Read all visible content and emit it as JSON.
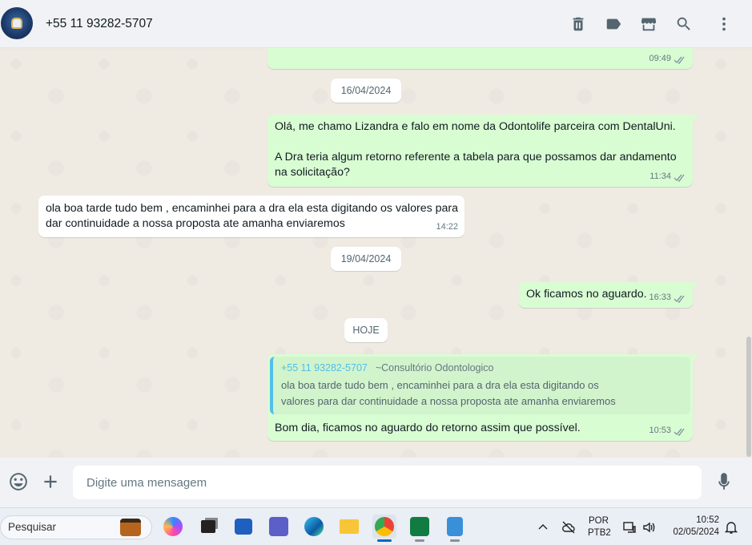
{
  "header": {
    "contact": "+55 11 93282-5707",
    "icons": [
      "delete-icon",
      "label-icon",
      "store-icon",
      "search-icon",
      "menu-icon"
    ]
  },
  "chat": {
    "first_bubble_time": "09:49",
    "date_1": "16/04/2024",
    "msg_1": {
      "para_1": "Olá, me chamo Lizandra e falo em nome da Odontolife parceira com DentalUni.",
      "para_2": "A Dra teria algum retorno referente a tabela para que possamos dar andamento na solicitação?",
      "time": "11:34"
    },
    "msg_2": {
      "text": "ola boa tarde tudo bem , encaminhei para a dra ela esta digitando os valores para dar continuidade a nossa proposta ate amanha enviaremos",
      "time": "14:22"
    },
    "date_2": "19/04/2024",
    "msg_3": {
      "text": "Ok ficamos no aguardo.",
      "time": "16:33"
    },
    "date_3": "HOJE",
    "msg_4": {
      "quote_name": "+55 11 93282-5707",
      "quote_alias": "~Consultório Odontologico",
      "quote_line_1": "ola boa tarde tudo bem , encaminhei para a dra ela esta digitando os",
      "quote_line_2": "valores para dar continuidade a nossa proposta ate amanha enviaremos",
      "text": "Bom dia, ficamos no aguardo do retorno assim que possível.",
      "time": "10:53"
    }
  },
  "composer": {
    "placeholder": "Digite uma mensagem"
  },
  "taskbar": {
    "search_label": "Pesquisar",
    "lang_1": "POR",
    "lang_2": "PTB2",
    "time": "10:52",
    "date": "02/05/2024"
  },
  "colors": {
    "outgoing": "#d9fdd3",
    "incoming": "#ffffff",
    "chat_bg": "#efeae2",
    "quote_accent": "#53bdeb"
  }
}
